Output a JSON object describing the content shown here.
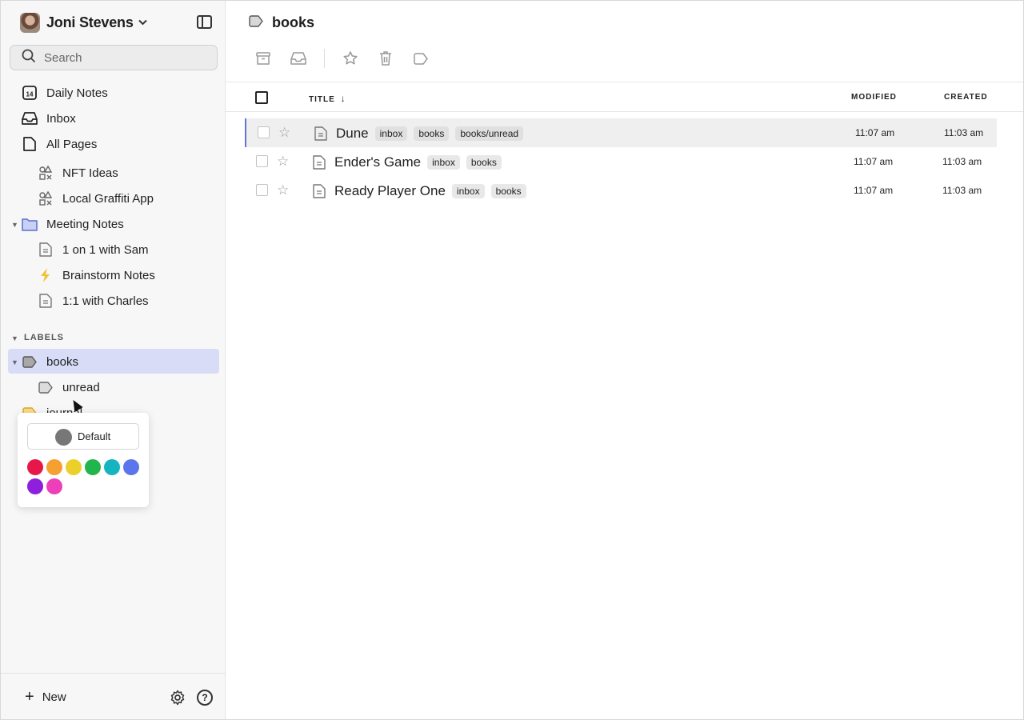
{
  "sidebar": {
    "user": {
      "name": "Joni Stevens"
    },
    "search": {
      "placeholder": "Search"
    },
    "nav": {
      "daily_notes": "Daily Notes",
      "daily_badge": "14",
      "inbox": "Inbox",
      "all_pages": "All Pages"
    },
    "pages": [
      {
        "label": "NFT Ideas",
        "icon": "shapes-icon"
      },
      {
        "label": "Local Graffiti App",
        "icon": "shapes-icon"
      },
      {
        "label": "Meeting Notes",
        "icon": "folder-icon"
      },
      {
        "label": "1 on 1 with Sam",
        "icon": "document-icon"
      },
      {
        "label": "Brainstorm Notes",
        "icon": "lightning-icon"
      },
      {
        "label": "1:1 with Charles",
        "icon": "document-icon"
      }
    ],
    "labels_heading": "LABELS",
    "labels": [
      {
        "label": "books"
      },
      {
        "label": "unread"
      },
      {
        "label": "journal"
      }
    ],
    "bottom": {
      "new_label": "New",
      "help_glyph": "?"
    }
  },
  "color_picker": {
    "default_label": "Default",
    "default_color": "#777777",
    "colors": [
      "#e8174a",
      "#f5a030",
      "#ebd02b",
      "#23b54d",
      "#15b4c0",
      "#5b76ea",
      "#8d1fdd",
      "#ee3fba"
    ]
  },
  "main": {
    "title": "books",
    "columns": {
      "title": "TITLE",
      "sort_arrow": "↓",
      "modified": "MODIFIED",
      "created": "CREATED"
    },
    "rows": [
      {
        "title": "Dune",
        "tags": [
          "inbox",
          "books",
          "books/unread"
        ],
        "modified": "11:07 am",
        "created": "11:03 am"
      },
      {
        "title": "Ender's Game",
        "tags": [
          "inbox",
          "books"
        ],
        "modified": "11:07 am",
        "created": "11:03 am"
      },
      {
        "title": "Ready Player One",
        "tags": [
          "inbox",
          "books"
        ],
        "modified": "11:07 am",
        "created": "11:03 am"
      }
    ]
  }
}
